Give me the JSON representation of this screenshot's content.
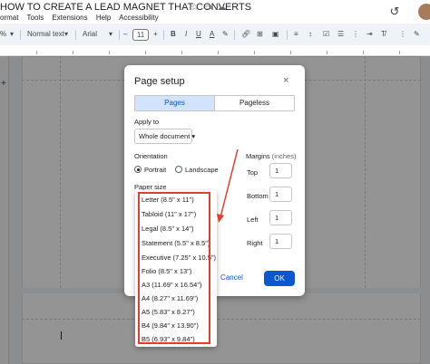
{
  "doc": {
    "title": "HOW TO CREATE A LEAD MAGNET THAT CONVERTS",
    "menu": [
      "ormat",
      "Tools",
      "Extensions",
      "Help",
      "Accessibility"
    ]
  },
  "toolbar": {
    "zoom": "%",
    "style": "Normal text",
    "font": "Arial",
    "minus": "–",
    "font_size": "11",
    "plus": "+"
  },
  "dialog": {
    "title": "Page setup",
    "close": "×",
    "tabs": [
      "Pages",
      "Pageless"
    ],
    "apply_to_label": "Apply to",
    "apply_to_value": "Whole document",
    "orientation_label": "Orientation",
    "portrait": "Portrait",
    "landscape": "Landscape",
    "paper_size_label": "Paper size",
    "margins_label": "Margins",
    "margins_unit": "(inches)",
    "margins": [
      {
        "label": "Top",
        "value": "1"
      },
      {
        "label": "Bottom",
        "value": "1"
      },
      {
        "label": "Left",
        "value": "1"
      },
      {
        "label": "Right",
        "value": "1"
      }
    ],
    "cancel": "Cancel",
    "ok": "OK"
  },
  "paper_sizes": [
    "Letter (8.5\" x 11\")",
    "Tabloid (11\" x 17\")",
    "Legal (8.5\" x 14\")",
    "Statement (5.5\" x 8.5\")",
    "Executive (7.25\" x 10.5\")",
    "Folio (8.5\" x 13\")",
    "A3 (11.69\" x 16.54\")",
    "A4 (8.27\" x 11.69\")",
    "A5 (5.83\" x 8.27\")",
    "B4 (9.84\" x 13.90\")",
    "B5 (6.93\" x 9.84\")"
  ],
  "colors": {
    "accent": "#0b57d0",
    "tab_active_bg": "#d3e3fd",
    "annotation_red": "#e03e2f"
  }
}
